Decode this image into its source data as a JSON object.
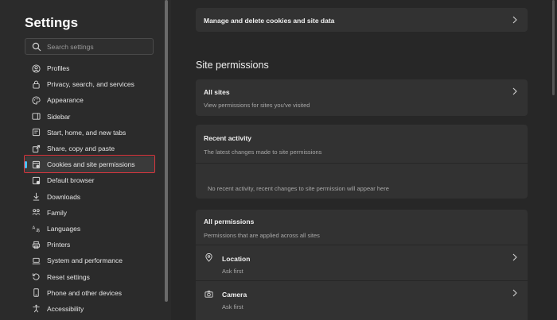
{
  "sidebar": {
    "title": "Settings",
    "search": {
      "placeholder": "Search settings",
      "value": ""
    },
    "items": [
      {
        "label": "Profiles",
        "icon": "profile-icon"
      },
      {
        "label": "Privacy, search, and services",
        "icon": "lock-icon"
      },
      {
        "label": "Appearance",
        "icon": "palette-icon"
      },
      {
        "label": "Sidebar",
        "icon": "sidebar-icon"
      },
      {
        "label": "Start, home, and new tabs",
        "icon": "home-icon"
      },
      {
        "label": "Share, copy and paste",
        "icon": "share-icon"
      },
      {
        "label": "Cookies and site permissions",
        "icon": "cookie-icon",
        "active": true
      },
      {
        "label": "Default browser",
        "icon": "browser-icon"
      },
      {
        "label": "Downloads",
        "icon": "download-icon"
      },
      {
        "label": "Family",
        "icon": "family-icon"
      },
      {
        "label": "Languages",
        "icon": "language-icon"
      },
      {
        "label": "Printers",
        "icon": "printer-icon"
      },
      {
        "label": "System and performance",
        "icon": "laptop-icon"
      },
      {
        "label": "Reset settings",
        "icon": "reset-icon"
      },
      {
        "label": "Phone and other devices",
        "icon": "phone-icon"
      },
      {
        "label": "Accessibility",
        "icon": "accessibility-icon"
      }
    ]
  },
  "main": {
    "cookies_card": {
      "title": "Manage and delete cookies and site data"
    },
    "section_title": "Site permissions",
    "all_sites": {
      "title": "All sites",
      "subtitle": "View permissions for sites you've visited"
    },
    "recent_activity": {
      "title": "Recent activity",
      "subtitle": "The latest changes made to site permissions",
      "empty_text": "No recent activity, recent changes to site permission will appear here"
    },
    "all_permissions": {
      "title": "All permissions",
      "subtitle": "Permissions that are applied across all sites",
      "items": [
        {
          "label": "Location",
          "value": "Ask first",
          "icon": "location-icon"
        },
        {
          "label": "Camera",
          "value": "Ask first",
          "icon": "camera-icon"
        }
      ]
    }
  },
  "colors": {
    "background": "#272727",
    "card": "#323232",
    "accent": "#4cc2ff",
    "highlight": "#d9363e"
  }
}
